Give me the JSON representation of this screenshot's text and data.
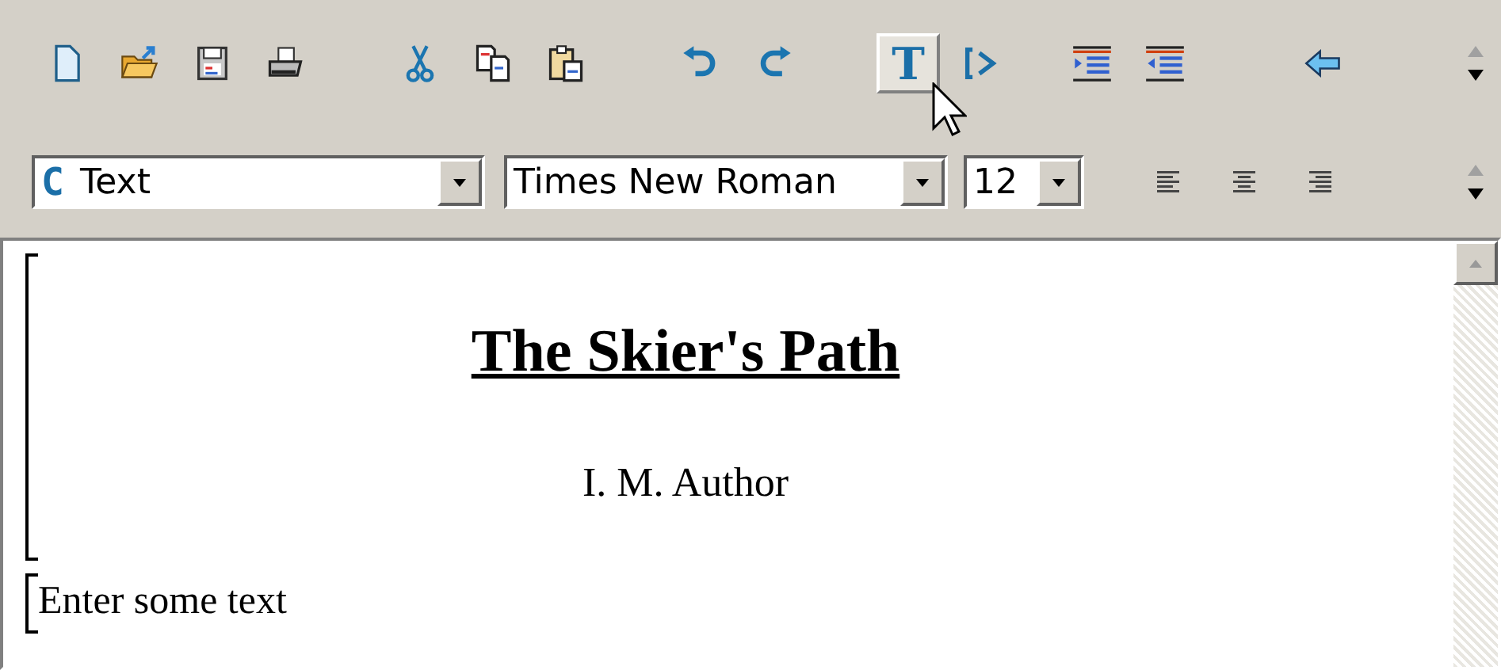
{
  "toolbar": {
    "groups": [
      [
        {
          "kind": "new",
          "raised": false
        },
        {
          "kind": "open",
          "raised": false
        },
        {
          "kind": "save",
          "raised": false
        },
        {
          "kind": "print",
          "raised": false
        }
      ],
      [
        {
          "kind": "cut",
          "raised": false
        },
        {
          "kind": "copy",
          "raised": false
        },
        {
          "kind": "paste",
          "raised": false
        }
      ],
      [
        {
          "kind": "undo",
          "raised": false
        },
        {
          "kind": "redo",
          "raised": false
        }
      ],
      [
        {
          "kind": "letter",
          "label": "T",
          "raised": true
        },
        {
          "kind": "tag",
          "raised": false
        }
      ],
      [
        {
          "kind": "indent",
          "raised": false
        },
        {
          "kind": "outdent",
          "raised": false
        }
      ],
      [
        {
          "kind": "back",
          "raised": false
        }
      ]
    ]
  },
  "format_bar": {
    "style": {
      "icon_letter": "C",
      "value": "Text"
    },
    "font": {
      "value": "Times New Roman"
    },
    "size": {
      "value": "12"
    },
    "align": [
      {
        "kind": "left"
      },
      {
        "kind": "center"
      },
      {
        "kind": "right"
      }
    ]
  },
  "document": {
    "blocks": [
      {
        "kind": "title",
        "text": "The Skier's Path"
      },
      {
        "kind": "author",
        "text": "I. M. Author"
      },
      {
        "kind": "body",
        "text": "Enter some text"
      }
    ]
  }
}
